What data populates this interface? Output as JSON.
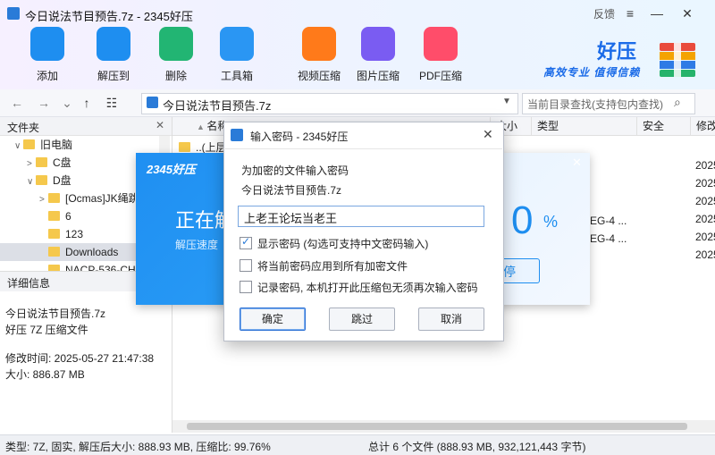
{
  "window": {
    "title": "今日说法节目预告.7z - 2345好压",
    "feedback": "反馈",
    "controls": [
      "≡",
      "—",
      "✕"
    ]
  },
  "toolbar": [
    {
      "label": "添加",
      "icon": "add-box-icon",
      "color": "#1e8ef0"
    },
    {
      "label": "解压到",
      "icon": "extract-box-icon",
      "color": "#1e8ef0"
    },
    {
      "label": "删除",
      "icon": "recycle-icon",
      "color": "#22b573"
    },
    {
      "label": "工具箱",
      "icon": "toolbox-icon",
      "color": "#2a96f3"
    },
    {
      "label": "视频压缩",
      "icon": "video-compress-icon",
      "color": "#ff7a1a"
    },
    {
      "label": "图片压缩",
      "icon": "image-compress-icon",
      "color": "#7a5cf2"
    },
    {
      "label": "PDF压缩",
      "icon": "pdf-compress-icon",
      "color": "#ff4d6a"
    }
  ],
  "brand": {
    "name": "好压",
    "slogan": "高效专业 值得信赖"
  },
  "address": {
    "path": "今日说法节目预告.7z",
    "search_placeholder": "当前目录查找(支持包内查找)"
  },
  "tree": {
    "header": "文件夹",
    "items": [
      {
        "label": "旧电脑",
        "indent": 1,
        "chev": "∨"
      },
      {
        "label": "C盘",
        "indent": 2,
        "chev": ">"
      },
      {
        "label": "D盘",
        "indent": 2,
        "chev": "∨"
      },
      {
        "label": "[Ocmas]JK绳跳",
        "indent": 3,
        "chev": ">"
      },
      {
        "label": "6",
        "indent": 3,
        "chev": ""
      },
      {
        "label": "123",
        "indent": 3,
        "chev": ""
      },
      {
        "label": "Downloads",
        "indent": 3,
        "chev": "",
        "selected": true
      },
      {
        "label": "NACP-536-CH",
        "indent": 3,
        "chev": ""
      }
    ]
  },
  "details": {
    "header": "详细信息",
    "filename": "今日说法节目预告.7z",
    "filetype": "好压 7Z 压缩文件",
    "modified": "修改时间: 2025-05-27 21:47:38",
    "size": "大小: 886.87 MB"
  },
  "list": {
    "columns": [
      "名称",
      "大小",
      "类型",
      "安全",
      "修改"
    ],
    "first_row": "..(上层",
    "type_cells": [
      "EG-4 ...",
      "EG-4 ..."
    ],
    "date_cells": [
      "2025",
      "2025",
      "2025",
      "2025",
      "2025",
      "2025"
    ]
  },
  "status": {
    "left": "类型: 7Z, 固实, 解压后大小: 888.93 MB, 压缩比: 99.76%",
    "right": "总计 6 个文件 (888.93 MB, 932,121,443 字节)"
  },
  "progress_dialog": {
    "brand": "2345好压",
    "status": "正在解",
    "speed_label": "解压速度",
    "percent": "0",
    "percent_unit": "%",
    "pause_label": "停",
    "progress": 0
  },
  "password_dialog": {
    "title": "输入密码 - 2345好压",
    "prompt": "为加密的文件输入密码",
    "filename": "今日说法节目预告.7z",
    "password_value": "上老王论坛当老王",
    "options": [
      {
        "label": "显示密码 (勾选可支持中文密码输入)",
        "checked": true
      },
      {
        "label": "将当前密码应用到所有加密文件",
        "checked": false
      },
      {
        "label": "记录密码, 本机打开此压缩包无须再次输入密码",
        "checked": false
      }
    ],
    "buttons": {
      "ok": "确定",
      "skip": "跳过",
      "cancel": "取消"
    }
  }
}
